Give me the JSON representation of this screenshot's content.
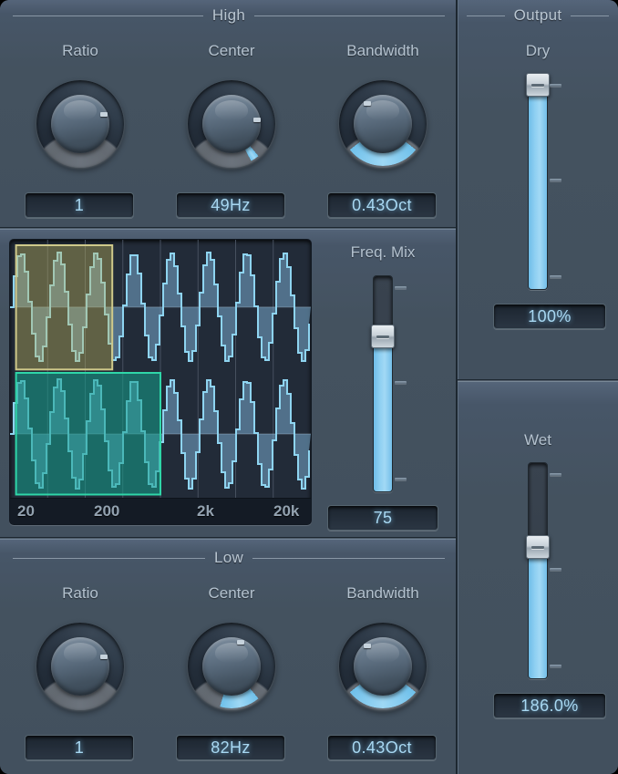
{
  "sections": {
    "high": {
      "title": "High",
      "controls": [
        {
          "label": "Ratio",
          "value": "1",
          "angle": -22,
          "arc_from": null,
          "arc_to": null
        },
        {
          "label": "Center",
          "value": "49Hz",
          "angle": -10,
          "arc_from": 140,
          "arc_to": 152
        },
        {
          "label": "Bandwidth",
          "value": "0.43Oct",
          "angle": -128,
          "arc_from": 128,
          "arc_to": 232
        }
      ]
    },
    "low": {
      "title": "Low",
      "controls": [
        {
          "label": "Ratio",
          "value": "1",
          "angle": -22,
          "arc_from": null,
          "arc_to": null
        },
        {
          "label": "Center",
          "value": "82Hz",
          "angle": -70,
          "arc_from": 140,
          "arc_to": 196
        },
        {
          "label": "Bandwidth",
          "value": "0.43Oct",
          "angle": -128,
          "arc_from": 128,
          "arc_to": 232
        }
      ]
    },
    "freq_mix": {
      "label": "Freq. Mix",
      "value": "75",
      "position_pct": 72
    },
    "output": {
      "title": "Output",
      "dry": {
        "label": "Dry",
        "value": "100%",
        "position_pct": 100
      },
      "wet": {
        "label": "Wet",
        "value": "186.0%",
        "position_pct": 61
      }
    }
  },
  "display": {
    "axis_labels": [
      "20",
      "200",
      "2k",
      "20k"
    ],
    "selection_high": {
      "name": "high-band-selection",
      "color": "#cfc98a",
      "fill": "rgba(190,180,90,0.40)"
    },
    "selection_low": {
      "name": "low-band-selection",
      "color": "#2fd6a8",
      "fill": "rgba(20,160,140,0.55)"
    },
    "waveform_color": "#8ed4f0"
  },
  "chart_data": {
    "type": "line",
    "title": "",
    "xlabel": "",
    "ylabel": "",
    "xticks": [
      "20",
      "200",
      "2k",
      "20k"
    ],
    "series": [
      {
        "name": "high-band-waveform",
        "cycles": 8,
        "amplitude": 1.0,
        "row": "top"
      },
      {
        "name": "low-band-waveform",
        "cycles": 8,
        "amplitude": 1.0,
        "row": "bottom"
      }
    ],
    "selections": [
      {
        "name": "high",
        "x_start_pct": 2,
        "x_end_pct": 34,
        "y_row": "top"
      },
      {
        "name": "low",
        "x_start_pct": 2,
        "x_end_pct": 50,
        "y_row": "bottom"
      }
    ],
    "grid": true,
    "legend": "none"
  },
  "colors": {
    "accent": "#8fd0f2",
    "panel": "#44525f",
    "value_text": "#a8d8f2",
    "label_text": "#b4c2cf"
  }
}
